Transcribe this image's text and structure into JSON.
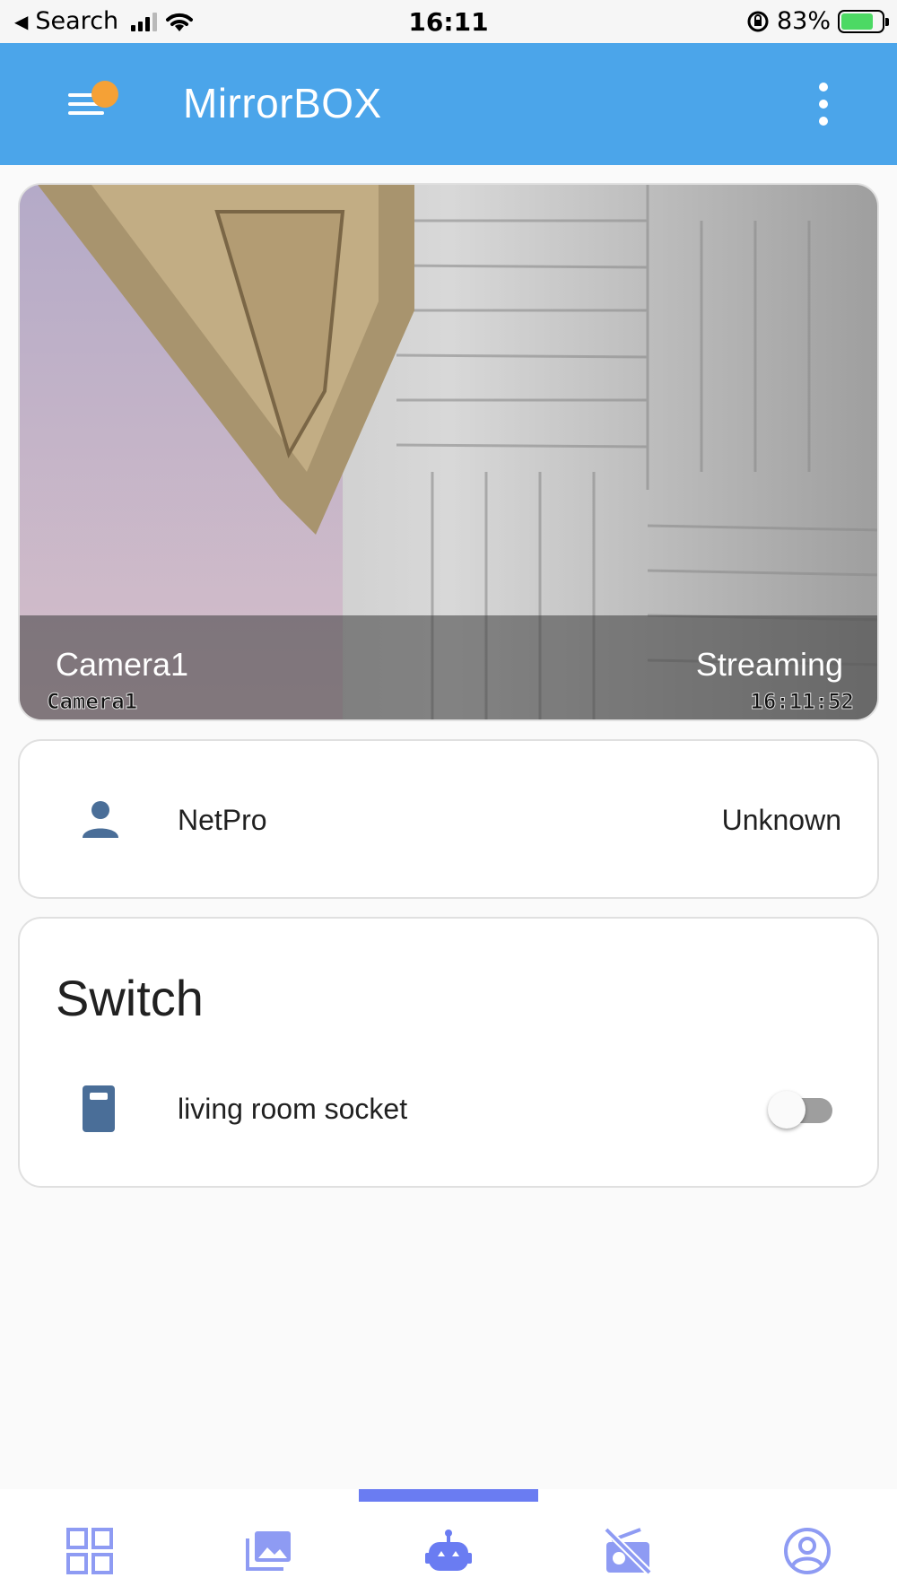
{
  "status_bar": {
    "back_glyph": "◀",
    "carrier": "Search",
    "time": "16:11",
    "battery_percent": "83%",
    "lock_glyph": "⟳"
  },
  "app_bar": {
    "title": "MirrorBOX",
    "menu_icon": "hamburger-menu-icon",
    "more_icon": "more-vert-icon",
    "notification_color": "#f5a136",
    "bar_color": "#4ba5ea"
  },
  "camera": {
    "name": "Camera1",
    "status": "Streaming",
    "osd_name": "Camera1",
    "osd_time": "16:11:52"
  },
  "person": {
    "icon": "person-icon",
    "name": "NetPro",
    "status": "Unknown"
  },
  "switch_section": {
    "title": "Switch",
    "items": [
      {
        "icon": "socket-icon",
        "label": "living room socket",
        "on": false
      }
    ]
  },
  "bottom_nav": {
    "accent_color": "#6a7cf2",
    "active_index": 2,
    "items": [
      {
        "icon": "dashboard-grid-icon"
      },
      {
        "icon": "gallery-icon"
      },
      {
        "icon": "robot-icon"
      },
      {
        "icon": "radio-off-icon"
      },
      {
        "icon": "account-circle-icon"
      }
    ]
  }
}
